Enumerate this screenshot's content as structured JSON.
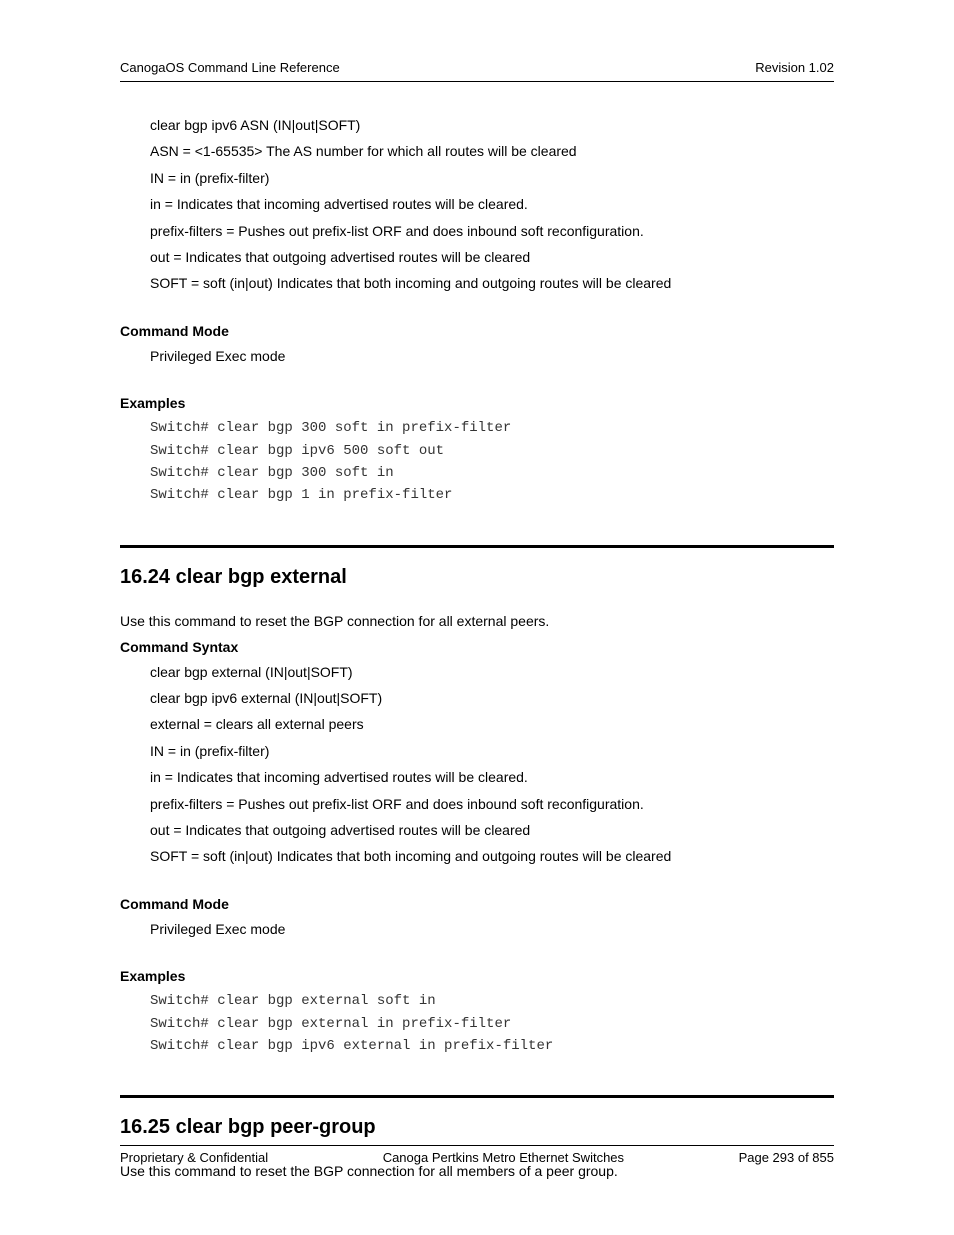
{
  "header": {
    "left": "CanogaOS Command Line Reference",
    "right": "Revision 1.02"
  },
  "upper": {
    "syntax_lines": [
      "clear bgp ipv6 ASN (IN|out|SOFT)",
      "ASN = <1-65535> The AS number for which all routes will be cleared",
      "IN = in (prefix-filter)",
      "in = Indicates that incoming advertised routes will be cleared.",
      "prefix-filters = Pushes out prefix-list ORF and does inbound soft reconfiguration.",
      "out = Indicates that outgoing advertised routes will be cleared",
      "SOFT = soft (in|out) Indicates that both incoming and outgoing routes will be cleared"
    ],
    "command_mode_label": "Command Mode",
    "command_mode_value": "Privileged Exec mode",
    "examples_label": "Examples",
    "examples_code": "Switch# clear bgp 300 soft in prefix-filter\nSwitch# clear bgp ipv6 500 soft out\nSwitch# clear bgp 300 soft in\nSwitch# clear bgp 1 in prefix-filter"
  },
  "section_1624": {
    "heading": "16.24  clear bgp external",
    "intro": "Use this command to reset the BGP connection for all external peers.",
    "command_syntax_label": "Command Syntax",
    "syntax_lines": [
      "clear bgp external (IN|out|SOFT)",
      "clear bgp ipv6 external (IN|out|SOFT)",
      "external = clears all external peers",
      "IN = in (prefix-filter)",
      "in = Indicates that incoming advertised routes will be cleared.",
      "prefix-filters = Pushes out prefix-list ORF and does inbound soft reconfiguration.",
      "out = Indicates that outgoing advertised routes will be cleared",
      "SOFT = soft (in|out) Indicates that both incoming and outgoing routes will be cleared"
    ],
    "command_mode_label": "Command Mode",
    "command_mode_value": "Privileged Exec mode",
    "examples_label": "Examples",
    "examples_code": "Switch# clear bgp external soft in\nSwitch# clear bgp external in prefix-filter\nSwitch# clear bgp ipv6 external in prefix-filter"
  },
  "section_1625": {
    "heading": "16.25  clear bgp peer-group",
    "intro": "Use this command to reset the BGP connection for all members of a peer group."
  },
  "footer": {
    "left": "Proprietary & Confidential",
    "center": "Canoga Pertkins Metro Ethernet Switches",
    "right": "Page 293 of 855"
  }
}
